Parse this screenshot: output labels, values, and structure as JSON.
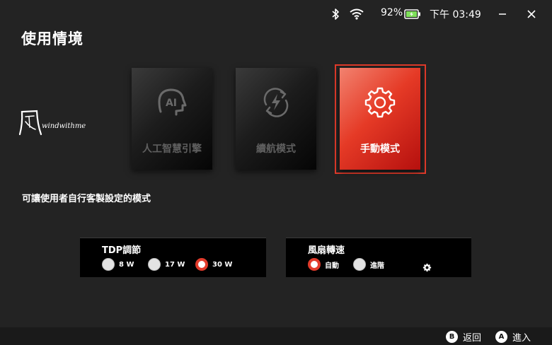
{
  "status": {
    "battery_percent": "92%",
    "time": "下午 03:49"
  },
  "page": {
    "title": "使用情境",
    "description": "可讓使用者自行客製設定的模式"
  },
  "logo": {
    "glyph": "風",
    "text": "windwithme"
  },
  "modes": [
    {
      "label": "人工智慧引擎",
      "icon": "ai-engine-icon",
      "selected": false
    },
    {
      "label": "續航模式",
      "icon": "battery-bolt-icon",
      "selected": false
    },
    {
      "label": "手動模式",
      "icon": "gear-icon",
      "selected": true
    }
  ],
  "tdp": {
    "title": "TDP調節",
    "options": [
      {
        "label": "8 W",
        "selected": false
      },
      {
        "label": "17 W",
        "selected": false
      },
      {
        "label": "30 W",
        "selected": true
      }
    ]
  },
  "fan": {
    "title": "風扇轉速",
    "options": [
      {
        "label": "自動",
        "selected": true
      },
      {
        "label": "進階",
        "selected": false
      }
    ],
    "settings_icon": "gear-icon"
  },
  "footer": {
    "back": {
      "button": "B",
      "label": "返回"
    },
    "enter": {
      "button": "A",
      "label": "進入"
    }
  },
  "colors": {
    "accent": "#e23b2b",
    "background": "#232323",
    "panel": "#000000"
  }
}
